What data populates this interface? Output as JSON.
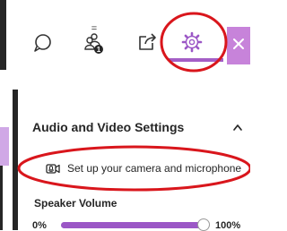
{
  "toolbar": {
    "tabs": [
      {
        "id": "chat",
        "icon": "chat-bubble-icon"
      },
      {
        "id": "attendees",
        "icon": "attendees-icon",
        "badge": "1",
        "handle": "="
      },
      {
        "id": "share",
        "icon": "share-content-icon"
      },
      {
        "id": "settings",
        "icon": "gear-icon",
        "selected": true
      }
    ],
    "close_icon": "close-icon"
  },
  "settings_panel": {
    "section_title": "Audio and Video Settings",
    "collapse_icon": "chevron-up-icon",
    "camera_setup": {
      "icon": "camera-microphone-icon",
      "label": "Set up your camera and microphone"
    },
    "speaker_volume": {
      "title": "Speaker Volume",
      "min_label": "0%",
      "max_label": "100%",
      "level": 0.96
    }
  },
  "colors": {
    "accent": "#a45ec6",
    "slider_fill": "#9b57c6",
    "close_background": "#c783da",
    "highlight_ring": "#d9161c",
    "text": "#262626"
  }
}
